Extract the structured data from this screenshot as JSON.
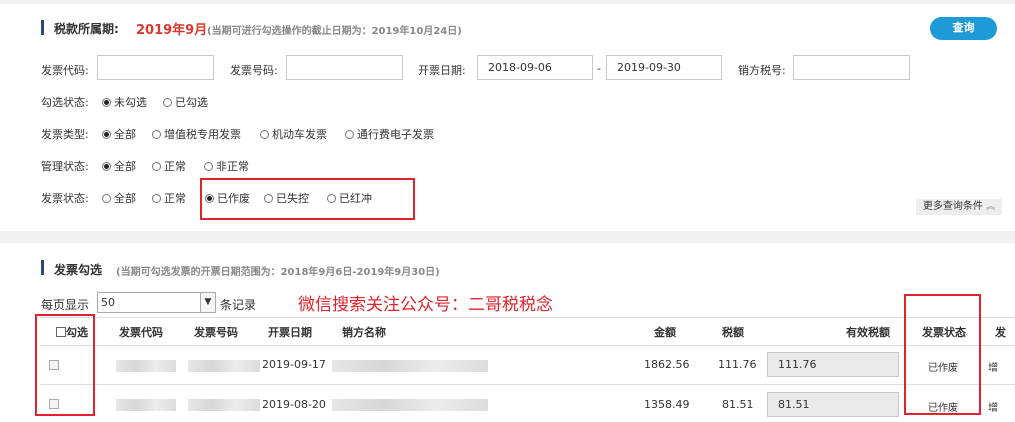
{
  "period": {
    "label": "税款所属期:",
    "value": "2019年9月",
    "note": "(当期可进行勾选操作的截止日期为：2019年10月24日)",
    "query_button": "查询"
  },
  "filters": {
    "invoice_code_label": "发票代码:",
    "invoice_code_value": "",
    "invoice_number_label": "发票号码:",
    "invoice_number_value": "",
    "issue_date_label": "开票日期:",
    "date_from": "2018-09-06",
    "date_sep": "-",
    "date_to": "2019-09-30",
    "seller_tax_label": "销方税号:",
    "seller_tax_value": "",
    "select_status_label": "勾选状态:",
    "select_status_options": [
      "未勾选",
      "已勾选"
    ],
    "invoice_type_label": "发票类型:",
    "invoice_type_options": [
      "全部",
      "增值税专用发票",
      "机动车发票",
      "通行费电子发票"
    ],
    "manage_status_label": "管理状态:",
    "manage_status_options": [
      "全部",
      "正常",
      "非正常"
    ],
    "invoice_status_label": "发票状态:",
    "invoice_status_options": [
      "全部",
      "正常",
      "已作废",
      "已失控",
      "已红冲"
    ],
    "more_conditions": "更多查询条件",
    "more_icon": "double-chevron-up-icon"
  },
  "selection": {
    "title": "发票勾选",
    "note": "(当期可勾选发票的开票日期范围为：2018年9月6日-2019年9月30日)",
    "page_size_label": "每页显示",
    "page_size_value": "50",
    "page_size_unit": "条记录",
    "watermark": "微信搜索关注公众号：二哥税税念"
  },
  "table": {
    "headers": [
      "勾选",
      "发票代码",
      "发票号码",
      "开票日期",
      "销方名称",
      "金额",
      "税额",
      "有效税额",
      "发票状态",
      "发"
    ],
    "rows": [
      {
        "date": "2019-09-17",
        "amount": "1862.56",
        "tax": "111.76",
        "valid_tax": "111.76",
        "status": "已作废",
        "type": "增"
      },
      {
        "date": "2019-08-20",
        "amount": "1358.49",
        "tax": "81.51",
        "valid_tax": "81.51",
        "status": "已作废",
        "type": "增"
      }
    ]
  },
  "colors": {
    "accent": "#1e9ad6",
    "highlight": "#e0232c",
    "title_bar": "#2b4a7a"
  }
}
